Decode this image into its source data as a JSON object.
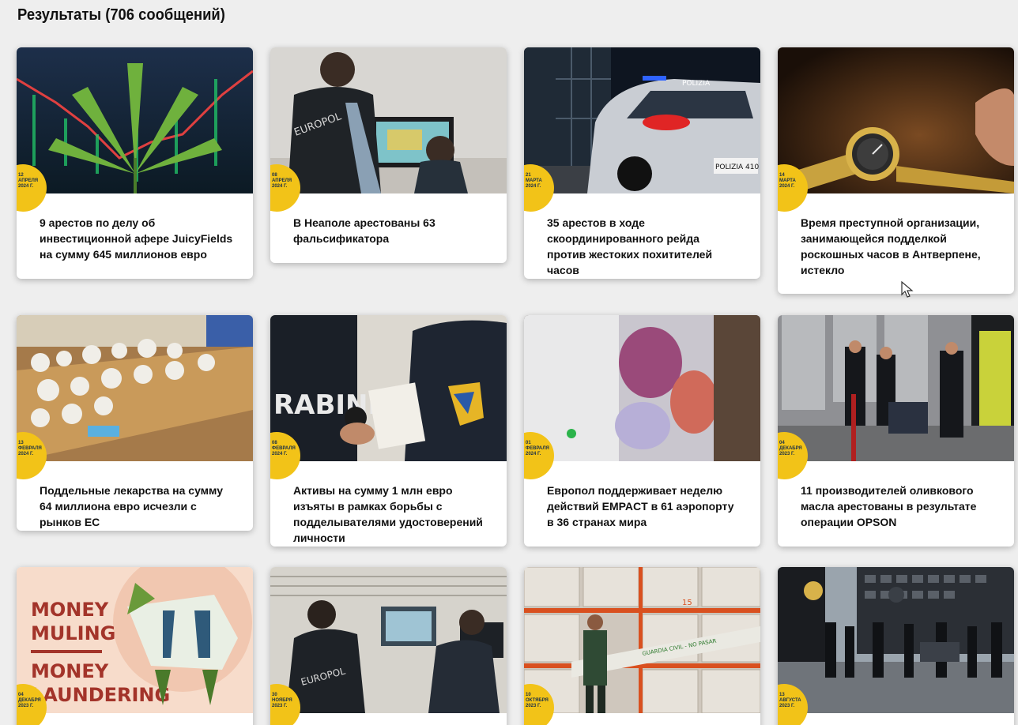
{
  "page": {
    "results_title": "Результаты (706 сообщений)"
  },
  "cards": [
    {
      "day": "12",
      "month": "АПРЕЛЯ",
      "year": "2024 Г.",
      "title": "9 арестов по делу об инвестиционной афере JuicyFields на сумму 645 миллионов евро",
      "image": "cannabis-leaf-with-stock-chart"
    },
    {
      "day": "08",
      "month": "АПРЕЛЯ",
      "year": "2024 Г.",
      "title": "В Неаполе арестованы 63 фальсификатора",
      "image": "europol-officer-viewing-banknote-on-monitor",
      "badge_text": "EUROPOL"
    },
    {
      "day": "21",
      "month": "МАРТА",
      "year": "2024 Г.",
      "title": "35 арестов в ходе скоординированного рейда против жестоких похитителей часов",
      "image": "italian-police-car-at-night",
      "car_text": "POLIZIA",
      "plate_text": "POLIZIA 410"
    },
    {
      "day": "14",
      "month": "МАРТА",
      "year": "2024 Г.",
      "title": "Время преступной организации, занимающейся подделкой роскошных часов в Антверпене, истекло",
      "image": "luxury-gold-watch-closeup"
    },
    {
      "day": "13",
      "month": "ФЕВРАЛЯ",
      "year": "2024 Г.",
      "title": "Поддельные лекарства на сумму 64 миллиона евро исчезли с рынков ЕС",
      "image": "seized-medicines-on-table"
    },
    {
      "day": "08",
      "month": "ФЕВРАЛЯ",
      "year": "2024 Г.",
      "title": "Активы на сумму 1 млн евро изъяты в рамках борьбы с подделывателями удостоверений личности",
      "image": "carabinieri-inspecting-document",
      "jacket_text": "RABINI"
    },
    {
      "day": "01",
      "month": "ФЕВРАЛЯ",
      "year": "2024 Г.",
      "title": "Европол поддерживает неделю действий EMPACT в 61 аэропорту в 36 странах мира",
      "image": "bags-of-seized-goods"
    },
    {
      "day": "04",
      "month": "ДЕКАБРЯ",
      "year": "2023 Г.",
      "title": "11 производителей оливкового масла арестованы в результате операции OPSON",
      "image": "carabinieri-at-oil-tanks"
    },
    {
      "day": "04",
      "month": "ДЕКАБРЯ",
      "year": "2023 Г.",
      "title": "",
      "image": "money-muling-illustration",
      "image_text": [
        "MONEY",
        "MULING",
        "MONEY",
        "LAUNDERING"
      ]
    },
    {
      "day": "30",
      "month": "НОЯБРЯ",
      "year": "2023 Г.",
      "title": "",
      "image": "europol-and-border-police-at-computers",
      "badge_text": "EUROPOL"
    },
    {
      "day": "10",
      "month": "ОКТЯБРЯ",
      "year": "2023 Г.",
      "title": "",
      "image": "guardia-civil-in-warehouse",
      "tape_text": "GUARDIA CIVIL - NO PASAR",
      "shelf_text": "15"
    },
    {
      "day": "13",
      "month": "АВГУСТА",
      "year": "2023 Г.",
      "title": "",
      "image": "spanish-police-raid-street"
    }
  ]
}
